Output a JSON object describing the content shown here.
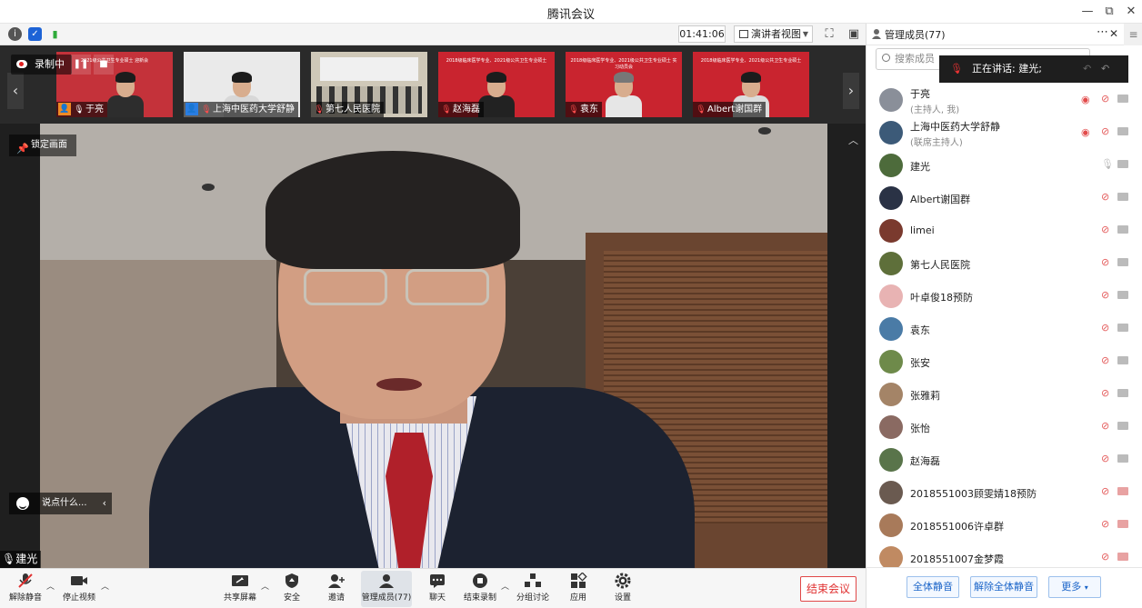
{
  "window": {
    "title": "腾讯会议"
  },
  "topbar": {
    "timer": "01:41:06",
    "view_mode": "演讲者视图"
  },
  "recording": {
    "label": "录制中"
  },
  "thumbnails": [
    {
      "name": "于亮",
      "banner": "2021级公共卫生专业硕士 迎新会"
    },
    {
      "name": "上海中医药大学舒静",
      "banner": ""
    },
    {
      "name": "第七人民医院",
      "banner": ""
    },
    {
      "name": "赵海磊",
      "banner": "2018级临床医学专业、2021级公共卫生专业硕士"
    },
    {
      "name": "袁东",
      "banner": "2018级临床医学专业、2021级公共卫生专业硕士 实习动员会"
    },
    {
      "name": "Albert谢国群",
      "banner": "2018级临床医学专业、2021级公共卫生专业硕士"
    }
  ],
  "main_video": {
    "pin_label": "锁定画面",
    "chat_placeholder": "说点什么...",
    "speaker_name": "建光"
  },
  "toolbar": {
    "unmute": "解除静音",
    "stop_video": "停止视频",
    "share": "共享屏幕",
    "security": "安全",
    "invite": "邀请",
    "members": "管理成员(77)",
    "chat": "聊天",
    "end_record": "结束录制",
    "breakout": "分组讨论",
    "apps": "应用",
    "settings": "设置",
    "end_meeting": "结束会议"
  },
  "panel": {
    "title": "管理成员(77)",
    "search_placeholder": "搜索成员",
    "speaking_now": "正在讲话: 建光;",
    "members": [
      {
        "name": "于亮",
        "role": "(主持人, 我)",
        "avatar": "#8a8f99"
      },
      {
        "name": "上海中医药大学舒静",
        "role": "(联席主持人)",
        "avatar": "#3c5a78"
      },
      {
        "name": "建光",
        "role": "",
        "avatar": "#4d6b3b"
      },
      {
        "name": "Albert谢国群",
        "role": "",
        "avatar": "#2a3245"
      },
      {
        "name": "limei",
        "role": "",
        "avatar": "#7a3a2e"
      },
      {
        "name": "第七人民医院",
        "role": "",
        "avatar": "#5e6f3a"
      },
      {
        "name": "叶卓俊18预防",
        "role": "",
        "avatar": "#e8b3b3"
      },
      {
        "name": "袁东",
        "role": "",
        "avatar": "#4a7ba6"
      },
      {
        "name": "张安",
        "role": "",
        "avatar": "#6e8a4a"
      },
      {
        "name": "张雅莉",
        "role": "",
        "avatar": "#a48467"
      },
      {
        "name": "张怡",
        "role": "",
        "avatar": "#8a6a62"
      },
      {
        "name": "赵海磊",
        "role": "",
        "avatar": "#59744a"
      },
      {
        "name": "2018551003顾雯婧18预防",
        "role": "",
        "avatar": "#6a5a50"
      },
      {
        "name": "2018551006许卓群",
        "role": "",
        "avatar": "#a87a5a"
      },
      {
        "name": "2018551007金梦霞",
        "role": "",
        "avatar": "#c08a62"
      }
    ],
    "mute_all": "全体静音",
    "unmute_all": "解除全体静音",
    "more": "更多"
  }
}
